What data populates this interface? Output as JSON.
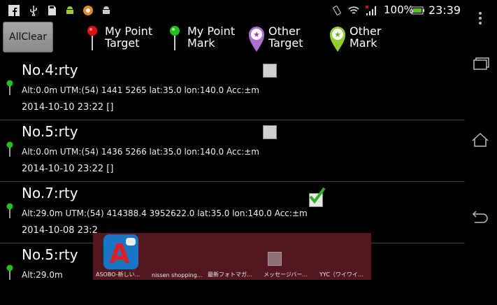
{
  "status": {
    "battery": "100%",
    "time": "23:39",
    "icons": [
      "facebook-icon",
      "usb-icon",
      "sd-card-icon",
      "android-icon",
      "app-icon",
      "android-icon",
      "vibrate-icon",
      "wifi-icon",
      "signal-icon",
      "battery-icon"
    ]
  },
  "toolbar": {
    "allclear_label": "AllClear",
    "legend": [
      {
        "label": "My Point\nTarget",
        "color": "#e01010"
      },
      {
        "label": "My Point\nMark",
        "color": "#20c020"
      },
      {
        "label": "Other\nTarget",
        "color": "#b070d0"
      },
      {
        "label": "Other\nMark",
        "color": "#90d030"
      }
    ]
  },
  "entries": [
    {
      "title": "No.4:rty",
      "info": "Alt:0.0m UTM:(54) 1441 5265 lat:35.0 lon:140.0 Acc:±m",
      "date": "2014-10-10 23:22  []",
      "checked": false
    },
    {
      "title": "No.5:rty",
      "info": "Alt:0.0m UTM:(54) 1436 5266 lat:35.0 lon:140.0 Acc:±m",
      "date": "2014-10-10 23:22  []",
      "checked": false
    },
    {
      "title": "No.7:rty",
      "info": "Alt:29.0m UTM:(54) 414388.4 3952622.0 lat:35.0 lon:140.0 Acc:±m",
      "date": "2014-10-08 23:2",
      "checked": true
    },
    {
      "title": "No.5:rty",
      "info": "Alt:29.0m",
      "date": "",
      "checked": false
    }
  ],
  "recents": [
    {
      "label": "ASOBO-新しい...",
      "icon": "asobo-app-icon"
    },
    {
      "label": "nissen shopping...",
      "icon": "app-icon"
    },
    {
      "label": "最新フォトマガ...",
      "icon": "app-icon"
    },
    {
      "label": "メッセージバー...",
      "icon": "app-icon"
    },
    {
      "label": "YYC（ワイワイ...",
      "icon": "app-icon"
    }
  ]
}
